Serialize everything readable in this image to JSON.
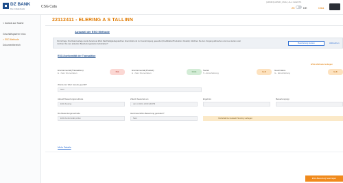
{
  "app": {
    "logo_text": "DZ BANK",
    "logo_sub": "Die Initiativbank",
    "title": "CSG Cata",
    "meta": "[ADMIN] ADMIN_MAIL | ALL CLIENTS",
    "badge": "25",
    "toggle_label": "DE",
    "orange_label": "Clea"
  },
  "sidebar": {
    "back_label": "< Zurück zur Suche",
    "items": [
      {
        "label": "Geschäftspartner Infos",
        "active": false
      },
      {
        "label": "> ESG Methode",
        "active": true
      },
      {
        "label": "Dokumentbereich",
        "active": false
      }
    ]
  },
  "main": {
    "page_title": "22112411 - ELERING A S TALLINN",
    "section_title": "Auswahl der ESG Methode",
    "info_text": "Für Anfrage: Die Datenvorlage wurde bereits an ESG Nachhaltigkeitsgutachten übermittelt und zur Genehmigung gesendet (Kreditfaktor/Produktion: Details). Möchten Sie den Vorgang abbrechen und neu starten oder möchten Sie den aktuellen Bearbeitungsstatus beibehalten?",
    "info_button": "Bearbeitung starten",
    "info_link": "Abbrechen",
    "sub_title": "ESG-Konformität der Transaktion",
    "sub_right": "ESG-Methode festlegen",
    "metrics": [
      {
        "label": "Environmental (Transaktion)",
        "sub": "E - Nein Score-Daten",
        "pill": "Rot",
        "color": "red"
      },
      {
        "label": "Environmental (Produkt)",
        "sub": "E - Nein Score-Daten",
        "pill": "Grün",
        "color": "green"
      },
      {
        "label": "Social",
        "sub": "S - Einschätzung",
        "pill": "Gelb",
        "color": "orange"
      },
      {
        "label": "Governance",
        "sub": "G - Einschätzung",
        "pill": "Gelb",
        "color": "orange"
      }
    ],
    "fields": {
      "q1_label": "Wurde der Wert bereits geprüft?",
      "q1_value": "Nein",
      "f1_label": "Aktuell Bewertungsmethode",
      "f1_value": "ESG Scoring",
      "f2_label": "Zuletzt bewertet am",
      "f2_value": "Jan 1 2023, 10:00 AM PM",
      "f3_label": "Ergebnis",
      "f3_value": "",
      "f4_label": "Bewertungstyp",
      "f4_value": "",
      "f5_label": "Die Bewertungsmethode",
      "f5_value": "ESG Konformität prüfen",
      "f6_label": "Hat diese ESG-Bewertung geändert?",
      "f6_value": "Nein",
      "warn_text": "Vorbehalt bei Auswahl Scoring vorliegen"
    },
    "more_link": "Mehr Details",
    "bottom_button": "ESG-Bewertung beantragen"
  },
  "colors": {
    "accent": "#e07a00",
    "brand": "#1f4e8c",
    "link": "#2e6fd3"
  }
}
